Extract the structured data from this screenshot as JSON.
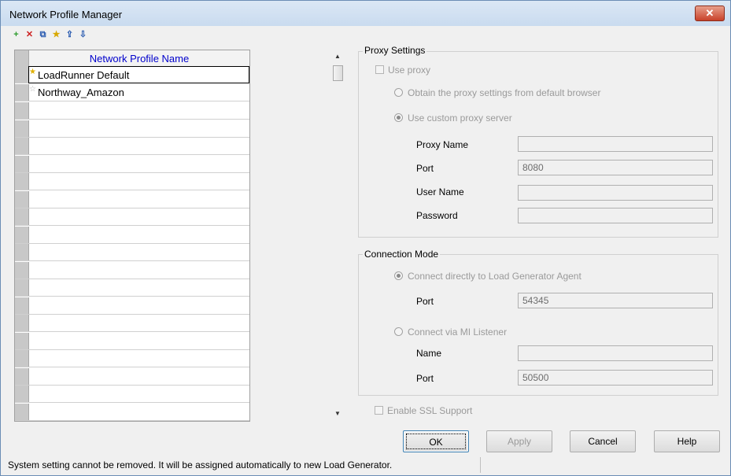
{
  "window": {
    "title": "Network Profile Manager",
    "close_glyph": "✕"
  },
  "toolbar": {
    "icons": [
      "add-icon",
      "delete-icon",
      "copy-icon",
      "set-default-icon",
      "import-icon",
      "export-icon"
    ],
    "glyphs": [
      "+",
      "✕",
      "⧉",
      "★",
      "⇪",
      "⇩"
    ],
    "colors": [
      "#2a9a2a",
      "#cc2020",
      "#2a5bb0",
      "#d8a800",
      "#2a5bb0",
      "#2a5bb0"
    ]
  },
  "grid": {
    "header": "Network Profile Name",
    "rows": [
      {
        "name": "LoadRunner Default",
        "star": "★"
      },
      {
        "name": "Northway_Amazon",
        "star": "☆"
      }
    ]
  },
  "proxy": {
    "title": "Proxy Settings",
    "use_proxy": "Use proxy",
    "obtain_browser": "Obtain the proxy settings from default browser",
    "use_custom": "Use custom proxy server",
    "proxy_name_label": "Proxy Name",
    "proxy_name_value": "",
    "port_label": "Port",
    "port_value": "8080",
    "user_name_label": "User Name",
    "user_name_value": "",
    "password_label": "Password",
    "password_value": ""
  },
  "connection": {
    "title": "Connection Mode",
    "direct": "Connect directly to Load Generator Agent",
    "direct_port_label": "Port",
    "direct_port_value": "54345",
    "mi": "Connect via MI Listener",
    "mi_name_label": "Name",
    "mi_name_value": "",
    "mi_port_label": "Port",
    "mi_port_value": "50500"
  },
  "ssl": {
    "label": "Enable SSL Support"
  },
  "buttons": {
    "ok": "OK",
    "apply": "Apply",
    "cancel": "Cancel",
    "help": "Help"
  },
  "status": {
    "text": "System setting cannot be removed. It will be assigned automatically to new Load Generator."
  }
}
